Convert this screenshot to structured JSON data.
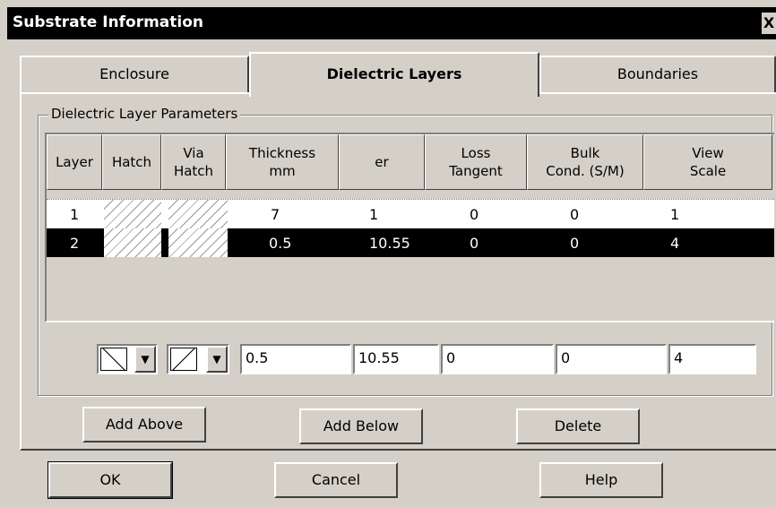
{
  "window": {
    "title": "Substrate Information",
    "close_label": "X"
  },
  "tabs": [
    {
      "label": "Enclosure",
      "active": false
    },
    {
      "label": "Dielectric Layers",
      "active": true
    },
    {
      "label": "Boundaries",
      "active": false
    }
  ],
  "group": {
    "label": "Dielectric Layer Parameters"
  },
  "table": {
    "headers": [
      {
        "line1": "Layer",
        "line2": ""
      },
      {
        "line1": "Hatch",
        "line2": ""
      },
      {
        "line1": "Via",
        "line2": "Hatch"
      },
      {
        "line1": "Thickness",
        "line2": "mm"
      },
      {
        "line1": "er",
        "line2": ""
      },
      {
        "line1": "Loss",
        "line2": "Tangent"
      },
      {
        "line1": "Bulk",
        "line2": "Cond. (S/M)"
      },
      {
        "line1": "View",
        "line2": "Scale"
      }
    ],
    "rows": [
      {
        "layer": "1",
        "thickness": "7",
        "er": "1",
        "loss": "0",
        "bulk": "0",
        "scale": "1",
        "selected": false
      },
      {
        "layer": "2",
        "thickness": "0.5",
        "er": "10.55",
        "loss": "0",
        "bulk": "0",
        "scale": "4",
        "selected": true
      }
    ]
  },
  "edit": {
    "thickness": "0.5",
    "er": "10.55",
    "loss": "0",
    "bulk": "0",
    "scale": "4"
  },
  "buttons": {
    "add_above": "Add Above",
    "add_below": "Add Below",
    "delete": "Delete",
    "ok": "OK",
    "cancel": "Cancel",
    "help": "Help"
  },
  "icons": {
    "dropdown": "chevron-down-icon",
    "hatch": "hatch-pattern-icon"
  }
}
